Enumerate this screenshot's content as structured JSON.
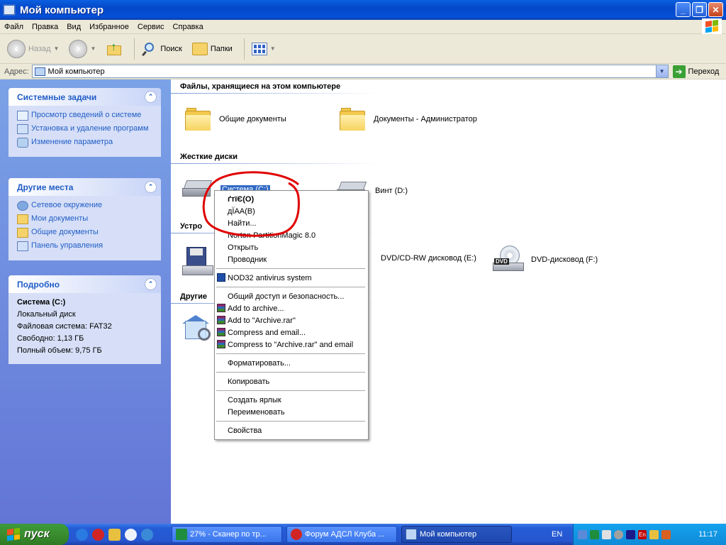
{
  "window": {
    "title": "Мой компьютер"
  },
  "menu": [
    "Файл",
    "Правка",
    "Вид",
    "Избранное",
    "Сервис",
    "Справка"
  ],
  "toolbar": {
    "back": "Назад",
    "search": "Поиск",
    "folders": "Папки"
  },
  "address": {
    "label": "Адрес:",
    "value": "Мой компьютер",
    "go": "Переход"
  },
  "tasks_panel": {
    "title": "Системные задачи",
    "items": [
      "Просмотр сведений о системе",
      "Установка и удаление программ",
      "Изменение параметра"
    ]
  },
  "places_panel": {
    "title": "Другие места",
    "items": [
      "Сетевое окружение",
      "Мои документы",
      "Общие документы",
      "Панель управления"
    ]
  },
  "details_panel": {
    "title": "Подробно",
    "name": "Система (C:)",
    "type": "Локальный диск",
    "fs": "Файловая система: FAT32",
    "free": "Свободно: 1,13 ГБ",
    "total": "Полный объем: 9,75 ГБ"
  },
  "groups": {
    "files": "Файлы, хранящиеся на этом компьютере",
    "drives": "Жесткие диски",
    "removable": "Устро",
    "other": "Другие"
  },
  "items": {
    "shared_docs": "Общие документы",
    "admin_docs": "Документы - Администратор",
    "drive_c": "Система (C:)",
    "drive_d": "Винт (D:)",
    "dvd_e": "DVD/CD-RW дисковод (E:)",
    "dvd_f": "DVD-дисковод (F:)",
    "dvd_tag": "DVD"
  },
  "context_menu": {
    "open_corrupt": "ґтїЄ(O)",
    "explore_corrupt": "дЇАА(B)",
    "find": "Найти...",
    "partition_magic": "Norton PartitionMagic 8.0",
    "open": "Открыть",
    "explorer": "Проводник",
    "nod32": "NOD32 antivirus system",
    "sharing": "Общий доступ и безопасность...",
    "add_archive": "Add to archive...",
    "add_rar": "Add to \"Archive.rar\"",
    "compress_email": "Compress and email...",
    "compress_rar_email": "Compress to \"Archive.rar\" and email",
    "format": "Форматировать...",
    "copy": "Копировать",
    "shortcut": "Создать ярлык",
    "rename": "Переименовать",
    "properties": "Свойства"
  },
  "taskbar": {
    "start": "пуск",
    "tasks": [
      "27% - Сканер по тр...",
      "Форум АДСЛ Клуба ...",
      "Мой компьютер"
    ],
    "lang": "EN",
    "tray_lang": "En",
    "clock": "11:17"
  },
  "colors": {
    "link": "#215dc6",
    "annotation": "#e00000",
    "selection": "#316ac5"
  }
}
